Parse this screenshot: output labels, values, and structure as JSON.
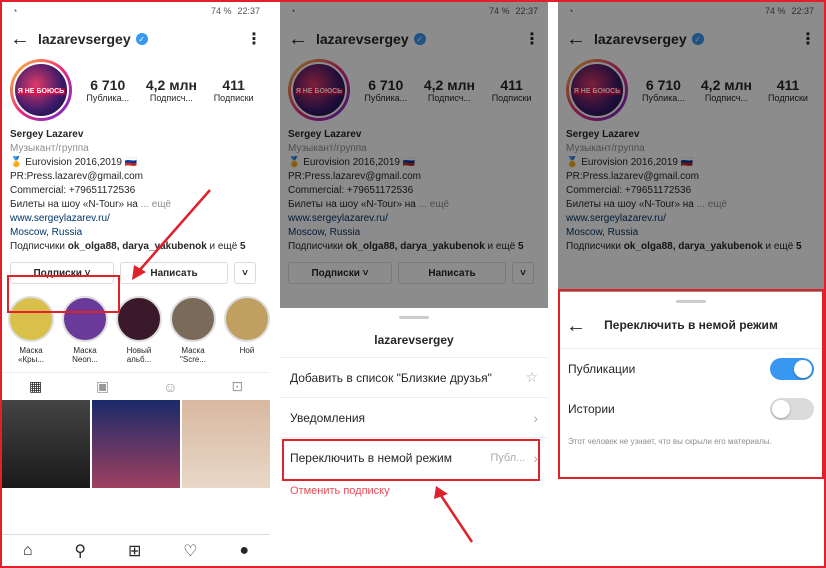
{
  "status": {
    "battery": "74 %",
    "time": "22:37"
  },
  "profile": {
    "username": "lazarevsergey",
    "avatar_text": "Я НЕ БОЮСЬ",
    "stats": [
      {
        "num": "6 710",
        "label": "Публика..."
      },
      {
        "num": "4,2 млн",
        "label": "Подписч..."
      },
      {
        "num": "411",
        "label": "Подписки"
      }
    ],
    "name": "Sergey Lazarev",
    "category": "Музыкант/группа",
    "bio_lines": [
      "🏅 Eurovision 2016,2019 🇷🇺",
      "PR:Press.lazarev@gmail.com",
      "Commercial: +79651172536",
      "Билеты на шоу «N-Tour» на"
    ],
    "bio_more": "... ещё",
    "website": "www.sergeylazarev.ru/",
    "location": "Moscow, Russia",
    "followed_prefix": "Подписчики",
    "followed_names": "ok_olga88, darya_yakubenok",
    "followed_suffix": "и ещё",
    "followed_count": "5",
    "follow_btn": "Подписки ˅",
    "message_btn": "Написать",
    "more_btn": "˅"
  },
  "stories": [
    "Маска «Кры...",
    "Маска Neon...",
    "Новый альб...",
    "Маска \"Scre...",
    "Ной"
  ],
  "sheet": {
    "title": "lazarevsergey",
    "items": [
      "Добавить в список \"Близкие друзья\"",
      "Уведомления",
      "Переключить в немой режим"
    ],
    "mute_value": "Публ...",
    "unfollow": "Отменить подписку"
  },
  "mute": {
    "title": "Переключить в немой режим",
    "posts_label": "Публикации",
    "stories_label": "Истории",
    "posts_on": true,
    "stories_on": false,
    "note": "Этот человек не узнает, что вы скрыли его материалы."
  },
  "colors": {
    "toggle_on": "#3897f0",
    "toggle_off": "#dbdbdb",
    "highlight": "#e0202a"
  }
}
